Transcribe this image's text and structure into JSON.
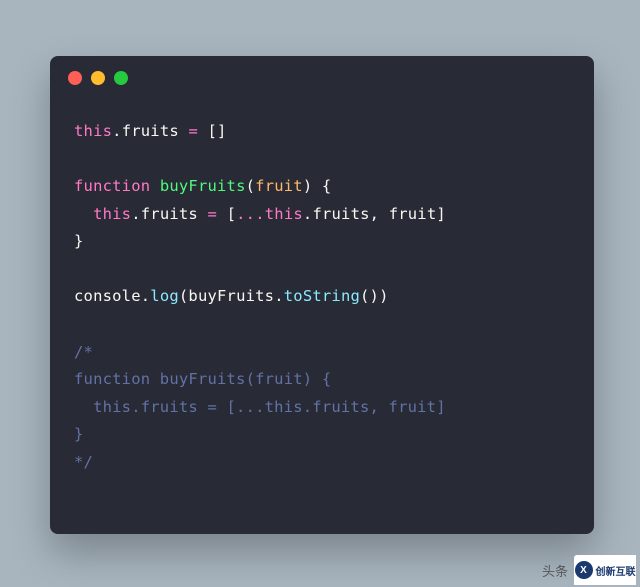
{
  "window": {
    "dots": {
      "red": "#ff5f56",
      "yellow": "#ffbd2e",
      "green": "#27c93f"
    }
  },
  "code": {
    "l1": {
      "a": "this",
      "b": ".",
      "c": "fruits",
      "d": " ",
      "e": "=",
      "f": " []"
    },
    "l3": {
      "a": "function",
      "b": " ",
      "c": "buyFruits",
      "d": "(",
      "e": "fruit",
      "f": ") {"
    },
    "l4": {
      "a": "  ",
      "b": "this",
      "c": ".",
      "d": "fruits",
      "e": " ",
      "f": "=",
      "g": " [",
      "h": "...",
      "i": "this",
      "j": ".",
      "k": "fruits",
      "l": ", fruit]"
    },
    "l5": {
      "a": "}"
    },
    "l7": {
      "a": "console",
      "b": ".",
      "c": "log",
      "d": "(buyFruits.",
      "e": "toString",
      "f": "())"
    },
    "c1": "/*",
    "c2": "function buyFruits(fruit) {",
    "c3": "  this.fruits = [...this.fruits, fruit]",
    "c4": "}",
    "c5": "*/"
  },
  "watermark": {
    "text": "头条",
    "logo": "创新互联"
  }
}
